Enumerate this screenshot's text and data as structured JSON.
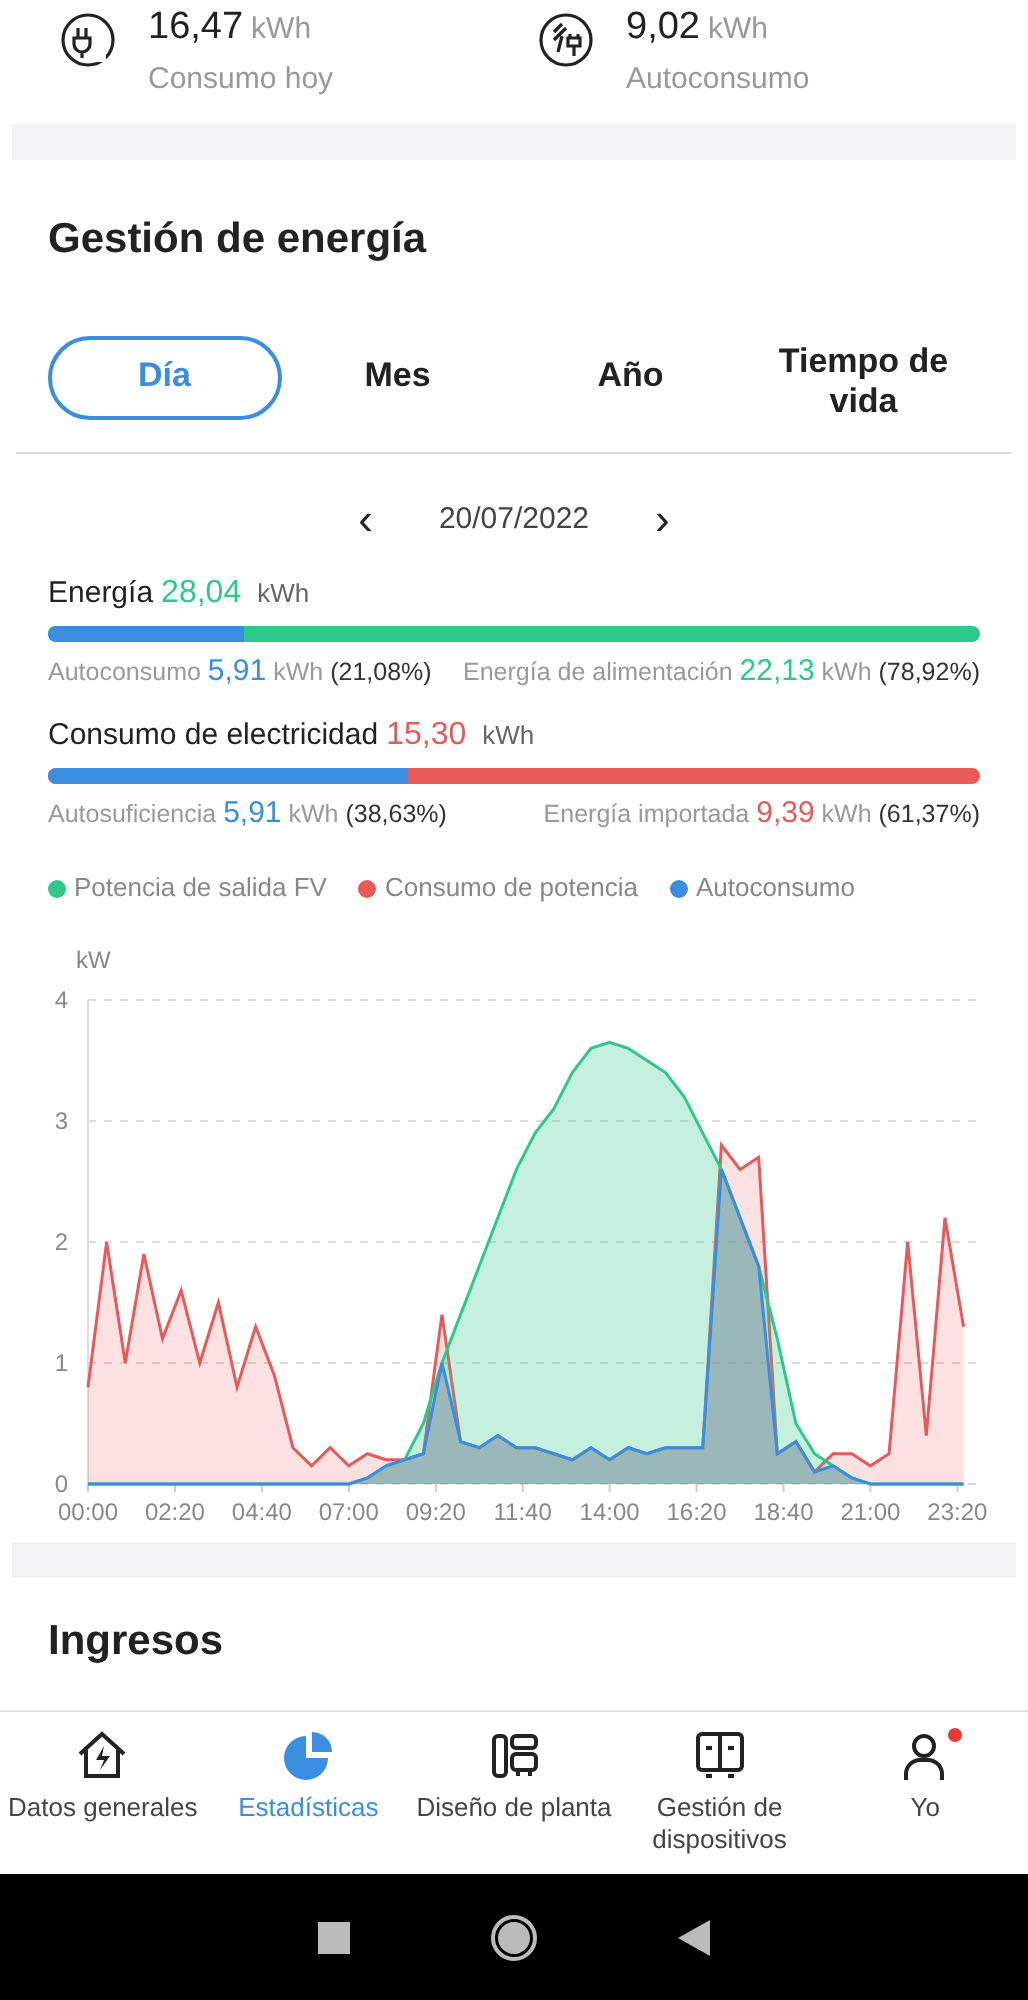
{
  "summary": [
    {
      "kind": "plug",
      "value": "16,47",
      "unit": "kWh",
      "label": "Consumo hoy"
    },
    {
      "kind": "solar",
      "value": "9,02",
      "unit": "kWh",
      "label": "Autoconsumo"
    }
  ],
  "energy_management": {
    "title": "Gestión de energía",
    "tabs": [
      {
        "label": "Día",
        "selected": true
      },
      {
        "label": "Mes",
        "selected": false
      },
      {
        "label": "Año",
        "selected": false
      },
      {
        "label": "Tiempo de vida",
        "selected": false
      }
    ],
    "date": {
      "prev": "‹",
      "value": "20/07/2022",
      "next": "›"
    },
    "balances": [
      {
        "title": "Energía",
        "total": "28,04",
        "unit": "kWh",
        "color": "#2ec98a",
        "level": 0.2108,
        "left": {
          "label": "Autoconsumo",
          "value": "5,91",
          "unit": "kWh",
          "percent": "(21,08%)",
          "color": "#3b8de0"
        },
        "right": {
          "label": "Energía de alimentación",
          "value": "22,13",
          "unit": "kWh",
          "percent": "(78,92%)",
          "color": "#2ec98a"
        }
      },
      {
        "title": "Consumo de electricidad",
        "total": "15,30",
        "unit": "kWh",
        "color": "#e85a5a",
        "level": 0.3863,
        "left": {
          "label": "Autosuficiencia",
          "value": "5,91",
          "unit": "kWh",
          "percent": "(38,63%)",
          "color": "#3b8de0"
        },
        "right": {
          "label": "Energía importada",
          "value": "9,39",
          "unit": "kWh",
          "percent": "(61,37%)",
          "color": "#e85a5a"
        }
      }
    ],
    "chart_data": {
      "type": "area",
      "grid": true,
      "ylabel": "kW",
      "ylim": [
        0,
        4
      ],
      "yticks": [
        0,
        1,
        2,
        3,
        4
      ],
      "xlim": [
        0,
        1430
      ],
      "xticks": [
        {
          "value": 0,
          "label": "00:00"
        },
        {
          "value": 140,
          "label": "02:20"
        },
        {
          "value": 280,
          "label": "04:40"
        },
        {
          "value": 420,
          "label": "07:00"
        },
        {
          "value": 560,
          "label": "09:20"
        },
        {
          "value": 700,
          "label": "11:40"
        },
        {
          "value": 840,
          "label": "14:00"
        },
        {
          "value": 980,
          "label": "16:20"
        },
        {
          "value": 1120,
          "label": "18:40"
        },
        {
          "value": 1260,
          "label": "21:00"
        },
        {
          "value": 1400,
          "label": "23:20"
        }
      ],
      "x": [
        0,
        30,
        60,
        90,
        120,
        150,
        180,
        210,
        240,
        270,
        300,
        330,
        360,
        390,
        420,
        450,
        480,
        510,
        540,
        570,
        600,
        630,
        660,
        690,
        720,
        750,
        780,
        810,
        840,
        870,
        900,
        930,
        960,
        990,
        1020,
        1050,
        1080,
        1110,
        1140,
        1170,
        1200,
        1230,
        1260,
        1290,
        1320,
        1350,
        1380,
        1410
      ],
      "series": [
        {
          "name": "Potencia de salida FV",
          "color": "#2ec98a",
          "values": [
            0,
            0,
            0,
            0,
            0,
            0,
            0,
            0,
            0,
            0,
            0,
            0,
            0,
            0,
            0,
            0.05,
            0.15,
            0.2,
            0.5,
            1.0,
            1.4,
            1.8,
            2.2,
            2.6,
            2.9,
            3.1,
            3.4,
            3.6,
            3.65,
            3.6,
            3.5,
            3.4,
            3.2,
            2.9,
            2.6,
            2.2,
            1.8,
            1.2,
            0.5,
            0.25,
            0.15,
            0.05,
            0,
            0,
            0,
            0,
            0,
            0
          ]
        },
        {
          "name": "Consumo de potencia",
          "color": "#e85a5a",
          "values": [
            0.8,
            2.0,
            1.0,
            1.9,
            1.2,
            1.6,
            1.0,
            1.5,
            0.8,
            1.3,
            0.9,
            0.3,
            0.15,
            0.3,
            0.15,
            0.25,
            0.2,
            0.2,
            0.25,
            1.4,
            0.35,
            0.3,
            0.4,
            0.3,
            0.3,
            0.25,
            0.2,
            0.3,
            0.2,
            0.3,
            0.25,
            0.3,
            0.3,
            0.3,
            2.8,
            2.6,
            2.7,
            0.25,
            0.35,
            0.1,
            0.25,
            0.25,
            0.15,
            0.25,
            2.0,
            0.4,
            2.2,
            1.3
          ]
        },
        {
          "name": "Autoconsumo",
          "color": "#3b8de0",
          "values": [
            0,
            0,
            0,
            0,
            0,
            0,
            0,
            0,
            0,
            0,
            0,
            0,
            0,
            0,
            0,
            0.05,
            0.15,
            0.2,
            0.25,
            1.0,
            0.35,
            0.3,
            0.4,
            0.3,
            0.3,
            0.25,
            0.2,
            0.3,
            0.2,
            0.3,
            0.25,
            0.3,
            0.3,
            0.3,
            2.6,
            2.2,
            1.8,
            0.25,
            0.35,
            0.1,
            0.15,
            0.05,
            0,
            0,
            0,
            0,
            0,
            0
          ]
        }
      ]
    }
  },
  "income": {
    "title": "Ingresos"
  },
  "bottom_nav": [
    {
      "kind": "house",
      "label": "Datos generales",
      "selected": false,
      "notification": false
    },
    {
      "kind": "pie",
      "label": "Estadísticas",
      "selected": true,
      "notification": false
    },
    {
      "kind": "layout",
      "label": "Diseño de planta",
      "selected": false,
      "notification": false
    },
    {
      "kind": "device",
      "label": "Gestión de dispositivos",
      "selected": false,
      "notification": false
    },
    {
      "kind": "person",
      "label": "Yo",
      "selected": false,
      "notification": true
    }
  ]
}
